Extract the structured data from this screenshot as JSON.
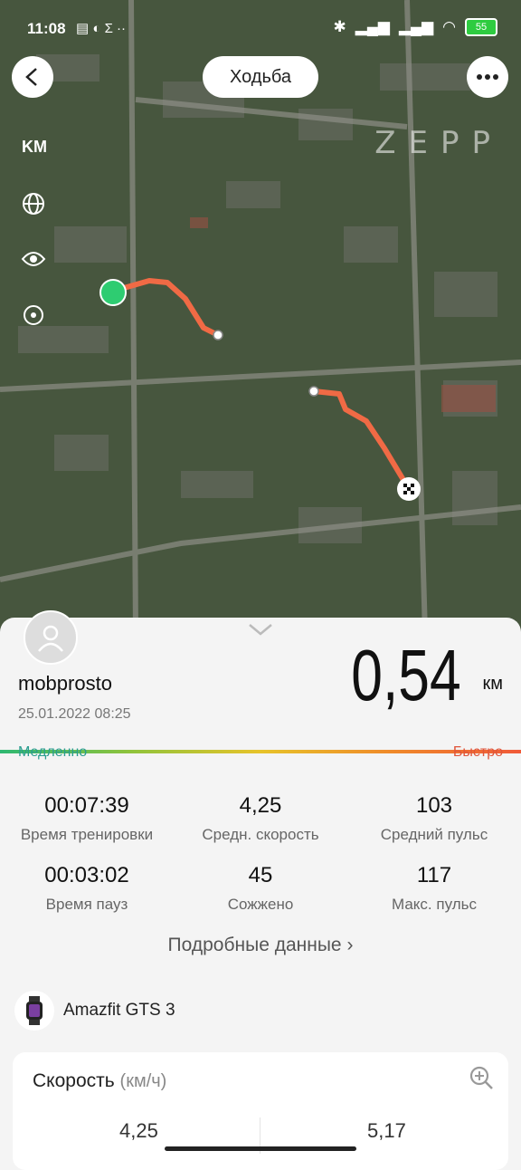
{
  "status": {
    "time": "11:08",
    "battery": "55"
  },
  "header": {
    "activity": "Ходьба",
    "watermark": "ZEPP",
    "unit": "KM"
  },
  "profile": {
    "name": "mobprosto",
    "datetime": "25.01.2022 08:25"
  },
  "distance": {
    "value": "0,54",
    "unit": "км"
  },
  "pace_scale": {
    "slow": "Медленно",
    "fast": "Быстро"
  },
  "stats": [
    {
      "value": "00:07:39",
      "label": "Время тренировки"
    },
    {
      "value": "4,25",
      "label": "Средн. скорость"
    },
    {
      "value": "103",
      "label": "Средний пульс"
    },
    {
      "value": "00:03:02",
      "label": "Время пауз"
    },
    {
      "value": "45",
      "label": "Сожжено"
    },
    {
      "value": "117",
      "label": "Макс. пульс"
    }
  ],
  "details_link": "Подробные данные",
  "device": {
    "name": "Amazfit GTS 3"
  },
  "speed_card": {
    "title": "Скорость",
    "unit": "(км/ч)",
    "avg": "4,25",
    "max": "5,17"
  },
  "colors": {
    "route": "#f06a45",
    "start": "#2ecc71",
    "accent_slow": "#2a9d8f",
    "accent_fast": "#e0553a"
  }
}
